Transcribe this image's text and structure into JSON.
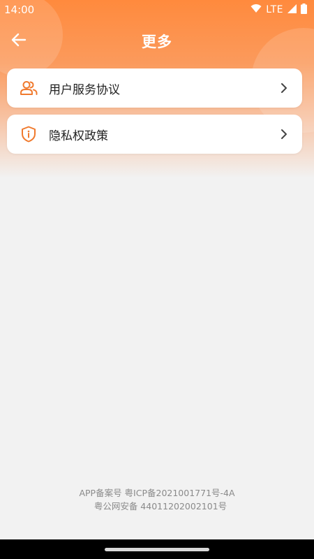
{
  "status_bar": {
    "time": "14:00",
    "network": "LTE"
  },
  "app_bar": {
    "title": "更多"
  },
  "menu": {
    "items": [
      {
        "label": "用户服务协议",
        "icon": "user-group-icon"
      },
      {
        "label": "隐私权政策",
        "icon": "shield-info-icon"
      }
    ]
  },
  "footer": {
    "line1": "APP备案号 粤ICP备2021001771号-4A",
    "line2": "粤公网安备 44011202002101号"
  },
  "colors": {
    "accent": "#ff8a3d",
    "icon": "#f07a2e",
    "background": "#f2f2f2"
  }
}
